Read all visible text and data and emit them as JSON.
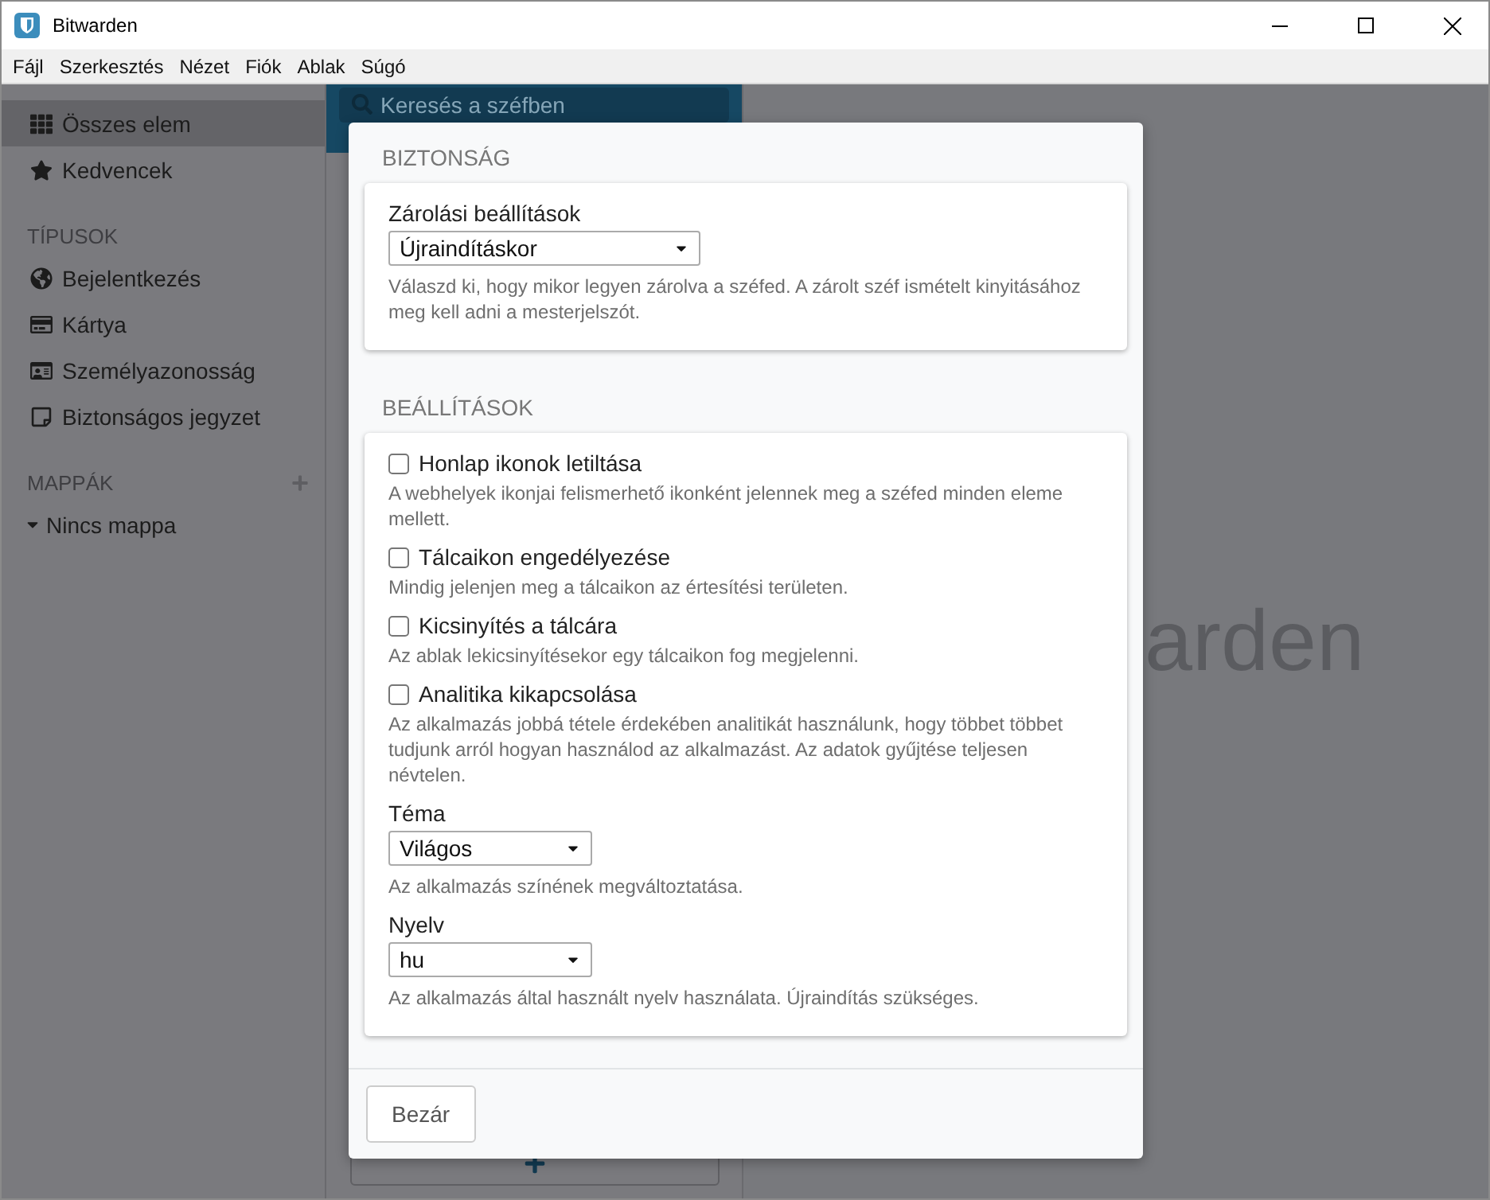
{
  "window": {
    "title": "Bitwarden"
  },
  "menu": [
    "Fájl",
    "Szerkesztés",
    "Nézet",
    "Fiók",
    "Ablak",
    "Súgó"
  ],
  "sidebar": {
    "items": [
      {
        "label": "Összes elem",
        "selected": true
      },
      {
        "label": "Kedvencek",
        "selected": false
      }
    ],
    "types": {
      "title": "TÍPUSOK",
      "items": [
        {
          "label": "Bejelentkezés"
        },
        {
          "label": "Kártya"
        },
        {
          "label": "Személyazonosság"
        },
        {
          "label": "Biztonságos jegyzet"
        }
      ]
    },
    "folders": {
      "title": "MAPPÁK",
      "items": [
        {
          "label": "Nincs mappa",
          "expanded": true
        }
      ]
    }
  },
  "list": {
    "search": {
      "placeholder": "Keresés a széfben"
    }
  },
  "main": {
    "logo_text": "arden"
  },
  "dialog": {
    "sections": [
      {
        "title": "BIZTONSÁG",
        "fields": [
          {
            "kind": "select",
            "label": "Zárolási beállítások",
            "value": "Újraindításkor",
            "help": "Válaszd ki, hogy mikor legyen zárolva a széfed. A zárolt széf ismételt kinyitásához meg kell adni a mesterjelszót."
          }
        ]
      },
      {
        "title": "BEÁLLÍTÁSOK",
        "fields": [
          {
            "kind": "checkbox",
            "label": "Honlap ikonok letiltása",
            "checked": false,
            "help": "A webhelyek ikonjai felismerhető ikonként jelennek meg a széfed minden eleme mellett."
          },
          {
            "kind": "checkbox",
            "label": "Tálcaikon engedélyezése",
            "checked": false,
            "help": "Mindig jelenjen meg a tálcaikon az értesítési területen."
          },
          {
            "kind": "checkbox",
            "label": "Kicsinyítés a tálcára",
            "checked": false,
            "help": "Az ablak lekicsinyítésekor egy tálcaikon fog megjelenni."
          },
          {
            "kind": "checkbox",
            "label": "Analitika kikapcsolása",
            "checked": false,
            "help": "Az alkalmazás jobbá tétele érdekében analitikát használunk, hogy többet többet tudjunk arról hogyan használod az alkalmazást. Az adatok gyűjtése teljesen névtelen."
          },
          {
            "kind": "select",
            "label": "Téma",
            "value": "Világos",
            "help": "Az alkalmazás színének megváltoztatása."
          },
          {
            "kind": "select",
            "label": "Nyelv",
            "value": "hu",
            "help": "Az alkalmazás által használt nyelv használata. Újraindítás szükséges."
          }
        ]
      }
    ],
    "buttons": [
      "Bezár"
    ]
  }
}
